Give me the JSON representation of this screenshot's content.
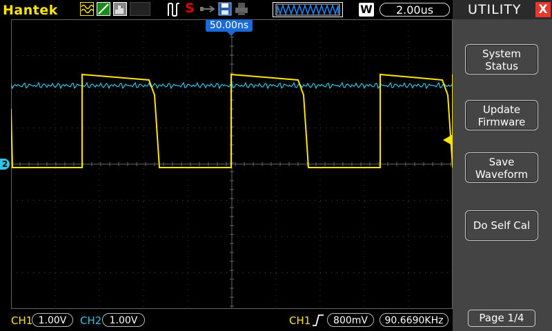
{
  "topbar": {
    "brand": "Hantek",
    "icons": [
      "waveform-math-icon",
      "ref-waveform-icon",
      "fft-icon",
      "run-stop-icon",
      "usb-icon",
      "save-icon",
      "print-icon"
    ],
    "trigger_status": "S",
    "mode_letter": "W",
    "timebase": "2.00us"
  },
  "grid": {
    "trigger_position": "50.00ns",
    "ch2_marker": "2"
  },
  "bottombar": {
    "ch1_label": "CH1",
    "ch1_scale": "1.00V",
    "ch2_label": "CH2",
    "ch2_scale": "1.00V",
    "trigger_source": "CH1",
    "trigger_level": "800mV",
    "frequency": "90.6690KHz"
  },
  "panel": {
    "title": "UTILITY",
    "close_label": "X",
    "buttons": [
      {
        "line1": "System",
        "line2": "Status"
      },
      {
        "line1": "Update",
        "line2": "Firmware"
      },
      {
        "line1": "Save",
        "line2": "Waveform"
      },
      {
        "line1": "Do Self Cal",
        "line2": ""
      }
    ],
    "page_label": "Page 1/4"
  },
  "colors": {
    "ch1": "#ffe600",
    "ch2": "#2cc7e8",
    "trigger_pos": "#1a6ad8",
    "close": "#e8382a"
  }
}
